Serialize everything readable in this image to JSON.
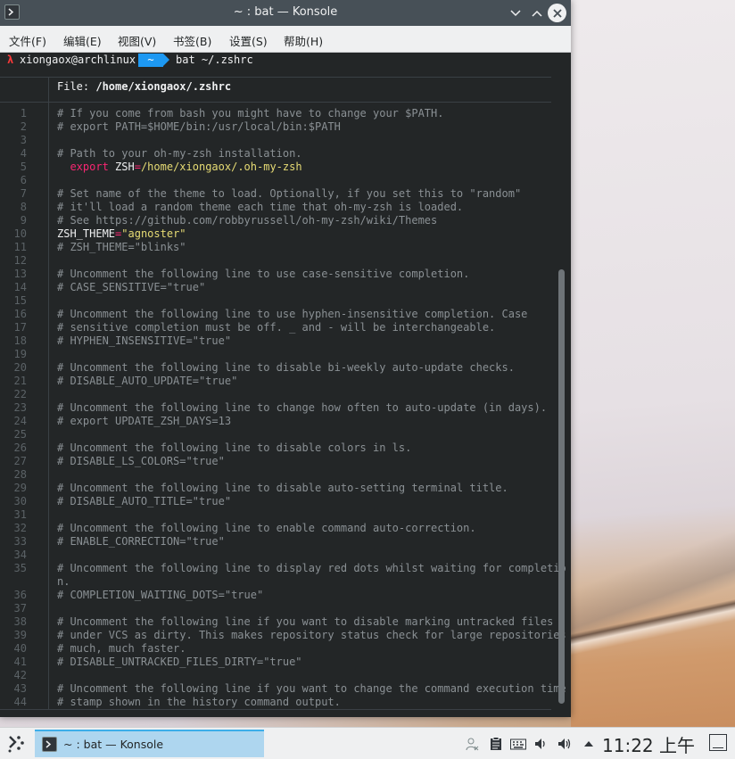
{
  "window": {
    "title": "~ : bat — Konsole",
    "menu": [
      "文件(F)",
      "编辑(E)",
      "视图(V)",
      "书签(B)",
      "设置(S)",
      "帮助(H)"
    ]
  },
  "terminal": {
    "prompt_arrow": "λ",
    "prompt_user": "xiongaox@archlinux",
    "prompt_dir": "~",
    "prompt_command": "bat ~/.zshrc",
    "file_label": "File: ",
    "file_path": "/home/xiongaox/.zshrc",
    "lines": [
      {
        "n": "1",
        "segments": [
          {
            "t": "# If you come from bash you might have to change your $PATH.",
            "c": "comment"
          }
        ]
      },
      {
        "n": "2",
        "segments": [
          {
            "t": "# export PATH=$HOME/bin:/usr/local/bin:$PATH",
            "c": "comment"
          }
        ]
      },
      {
        "n": "3",
        "segments": []
      },
      {
        "n": "4",
        "segments": [
          {
            "t": "# Path to your oh-my-zsh installation.",
            "c": "comment"
          }
        ]
      },
      {
        "n": "5",
        "segments": [
          {
            "t": "  ",
            "c": "plain"
          },
          {
            "t": "export",
            "c": "kw"
          },
          {
            "t": " ZSH",
            "c": "plain"
          },
          {
            "t": "=",
            "c": "kw"
          },
          {
            "t": "/home/xiongaox/.oh-my-zsh",
            "c": "str"
          }
        ]
      },
      {
        "n": "6",
        "segments": []
      },
      {
        "n": "7",
        "segments": [
          {
            "t": "# Set name of the theme to load. Optionally, if you set this to \"random\"",
            "c": "comment"
          }
        ]
      },
      {
        "n": "8",
        "segments": [
          {
            "t": "# it'll load a random theme each time that oh-my-zsh is loaded.",
            "c": "comment"
          }
        ]
      },
      {
        "n": "9",
        "segments": [
          {
            "t": "# See https://github.com/robbyrussell/oh-my-zsh/wiki/Themes",
            "c": "comment"
          }
        ]
      },
      {
        "n": "10",
        "segments": [
          {
            "t": "ZSH_THEME",
            "c": "plain"
          },
          {
            "t": "=",
            "c": "kw"
          },
          {
            "t": "\"agnoster\"",
            "c": "str"
          }
        ]
      },
      {
        "n": "11",
        "segments": [
          {
            "t": "# ZSH_THEME=\"blinks\"",
            "c": "comment"
          }
        ]
      },
      {
        "n": "12",
        "segments": []
      },
      {
        "n": "13",
        "segments": [
          {
            "t": "# Uncomment the following line to use case-sensitive completion.",
            "c": "comment"
          }
        ]
      },
      {
        "n": "14",
        "segments": [
          {
            "t": "# CASE_SENSITIVE=\"true\"",
            "c": "comment"
          }
        ]
      },
      {
        "n": "15",
        "segments": []
      },
      {
        "n": "16",
        "segments": [
          {
            "t": "# Uncomment the following line to use hyphen-insensitive completion. Case",
            "c": "comment"
          }
        ]
      },
      {
        "n": "17",
        "segments": [
          {
            "t": "# sensitive completion must be off. _ and - will be interchangeable.",
            "c": "comment"
          }
        ]
      },
      {
        "n": "18",
        "segments": [
          {
            "t": "# HYPHEN_INSENSITIVE=\"true\"",
            "c": "comment"
          }
        ]
      },
      {
        "n": "19",
        "segments": []
      },
      {
        "n": "20",
        "segments": [
          {
            "t": "# Uncomment the following line to disable bi-weekly auto-update checks.",
            "c": "comment"
          }
        ]
      },
      {
        "n": "21",
        "segments": [
          {
            "t": "# DISABLE_AUTO_UPDATE=\"true\"",
            "c": "comment"
          }
        ]
      },
      {
        "n": "22",
        "segments": []
      },
      {
        "n": "23",
        "segments": [
          {
            "t": "# Uncomment the following line to change how often to auto-update (in days).",
            "c": "comment"
          }
        ]
      },
      {
        "n": "24",
        "segments": [
          {
            "t": "# export UPDATE_ZSH_DAYS=13",
            "c": "comment"
          }
        ]
      },
      {
        "n": "25",
        "segments": []
      },
      {
        "n": "26",
        "segments": [
          {
            "t": "# Uncomment the following line to disable colors in ls.",
            "c": "comment"
          }
        ]
      },
      {
        "n": "27",
        "segments": [
          {
            "t": "# DISABLE_LS_COLORS=\"true\"",
            "c": "comment"
          }
        ]
      },
      {
        "n": "28",
        "segments": []
      },
      {
        "n": "29",
        "segments": [
          {
            "t": "# Uncomment the following line to disable auto-setting terminal title.",
            "c": "comment"
          }
        ]
      },
      {
        "n": "30",
        "segments": [
          {
            "t": "# DISABLE_AUTO_TITLE=\"true\"",
            "c": "comment"
          }
        ]
      },
      {
        "n": "31",
        "segments": []
      },
      {
        "n": "32",
        "segments": [
          {
            "t": "# Uncomment the following line to enable command auto-correction.",
            "c": "comment"
          }
        ]
      },
      {
        "n": "33",
        "segments": [
          {
            "t": "# ENABLE_CORRECTION=\"true\"",
            "c": "comment"
          }
        ]
      },
      {
        "n": "34",
        "segments": []
      },
      {
        "n": "35",
        "segments": [
          {
            "t": "# Uncomment the following line to display red dots whilst waiting for completio",
            "c": "comment"
          }
        ]
      },
      {
        "n": "",
        "segments": [
          {
            "t": "n.",
            "c": "comment"
          }
        ]
      },
      {
        "n": "36",
        "segments": [
          {
            "t": "# COMPLETION_WAITING_DOTS=\"true\"",
            "c": "comment"
          }
        ]
      },
      {
        "n": "37",
        "segments": []
      },
      {
        "n": "38",
        "segments": [
          {
            "t": "# Uncomment the following line if you want to disable marking untracked files",
            "c": "comment"
          }
        ]
      },
      {
        "n": "39",
        "segments": [
          {
            "t": "# under VCS as dirty. This makes repository status check for large repositories",
            "c": "comment"
          }
        ]
      },
      {
        "n": "40",
        "segments": [
          {
            "t": "# much, much faster.",
            "c": "comment"
          }
        ]
      },
      {
        "n": "41",
        "segments": [
          {
            "t": "# DISABLE_UNTRACKED_FILES_DIRTY=\"true\"",
            "c": "comment"
          }
        ]
      },
      {
        "n": "42",
        "segments": []
      },
      {
        "n": "43",
        "segments": [
          {
            "t": "# Uncomment the following line if you want to change the command execution time",
            "c": "comment"
          }
        ]
      },
      {
        "n": "44",
        "segments": [
          {
            "t": "# stamp shown in the history command output.",
            "c": "comment"
          }
        ]
      }
    ]
  },
  "taskbar": {
    "task_label": "~ : bat — Konsole",
    "clock": "11:22 上午",
    "tray_icons": [
      "user-icon",
      "clipboard-icon",
      "keyboard-icon",
      "volume-icon",
      "audio-icon",
      "expand-tray-icon"
    ]
  },
  "colors": {
    "terminal_bg": "#232627",
    "titlebar_bg": "#475057",
    "accent": "#1d99f3",
    "keyword": "#f92672",
    "string": "#e6db74"
  }
}
